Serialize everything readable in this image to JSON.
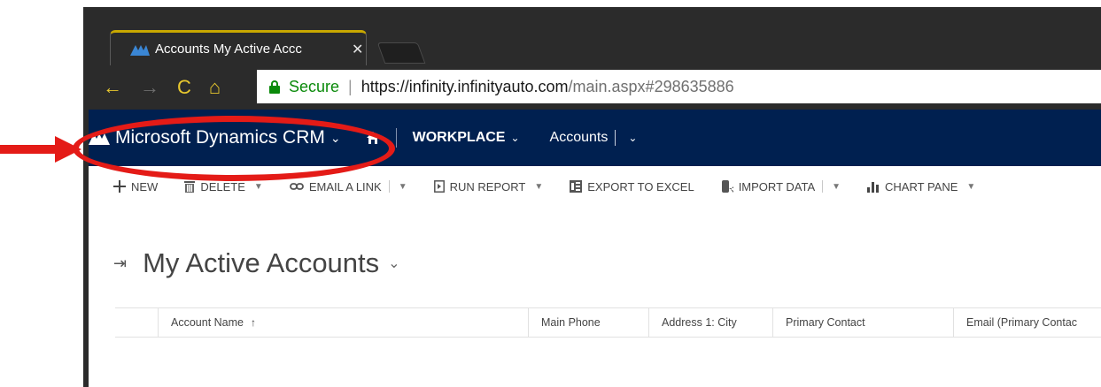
{
  "browser": {
    "tab_title": "Accounts My Active Accc",
    "tab_close": "✕",
    "nav": {
      "back": "←",
      "forward": "→",
      "reload": "C",
      "home": "⌂"
    },
    "secure_label": "Secure",
    "separator": "|",
    "url_scheme_host": "https://infinity.infinityauto.com",
    "url_path": "/main.aspx#298635886"
  },
  "crm_nav": {
    "brand": "Microsoft Dynamics CRM",
    "brand_chevron": "⌄",
    "workplace": "WORKPLACE",
    "workplace_chevron": "⌄",
    "accounts": "Accounts",
    "accounts_chevron": "⌄"
  },
  "commands": {
    "new": "NEW",
    "delete": "DELETE",
    "email_link": "EMAIL A LINK",
    "run_report": "RUN REPORT",
    "export_excel": "EXPORT TO EXCEL",
    "import_data": "IMPORT DATA",
    "chart_pane": "CHART PANE",
    "dropdown": "▼"
  },
  "view": {
    "title": "My Active Accounts",
    "chevron": "⌄",
    "pin": "⇥"
  },
  "grid": {
    "columns": [
      "Account Name",
      "Main Phone",
      "Address 1: City",
      "Primary Contact",
      "Email (Primary Contac"
    ],
    "sort_indicator": "↑"
  },
  "colors": {
    "crm_bar": "#002050",
    "annotation": "#e41b17",
    "browser_chrome": "#2b2b2b",
    "secure_green": "#0a8a0a",
    "nav_accent": "#e8c82e"
  }
}
